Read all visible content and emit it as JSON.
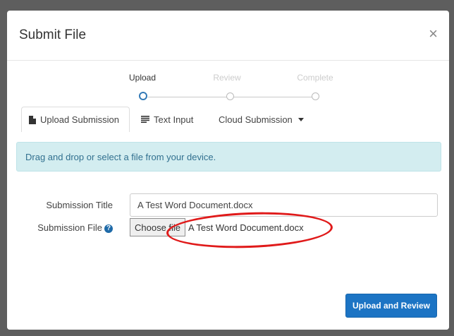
{
  "modal": {
    "title": "Submit File",
    "close_glyph": "×"
  },
  "stepper": {
    "steps": [
      {
        "label": "Upload",
        "state": "active"
      },
      {
        "label": "Review",
        "state": "inactive"
      },
      {
        "label": "Complete",
        "state": "inactive"
      }
    ]
  },
  "tabs": [
    {
      "label": "Upload Submission",
      "icon": "file-icon",
      "active": true
    },
    {
      "label": "Text Input",
      "icon": "text-lines-icon",
      "active": false
    },
    {
      "label": "Cloud Submission",
      "icon": "caret-down-icon",
      "active": false
    }
  ],
  "alert": {
    "text": "Drag and drop or select a file from your device."
  },
  "form": {
    "title_label": "Submission Title",
    "title_value": "A Test Word Document.docx",
    "file_label": "Submission File",
    "help_glyph": "?",
    "choose_button": "Choose file",
    "file_name": "A Test Word Document.docx"
  },
  "actions": {
    "upload_label": "Upload and Review"
  },
  "colors": {
    "primary": "#1c74c4",
    "alert_bg": "#d3edf0",
    "annotation": "#e01a1a",
    "backdrop": "#5e5e5e"
  }
}
